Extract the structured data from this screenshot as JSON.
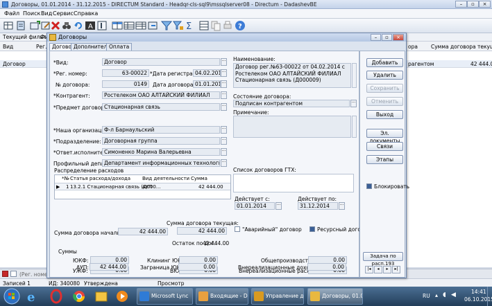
{
  "app": {
    "title": "Договоры, 01.01.2014 - 31.12.2015 - DIRECTUM Standard - Headqr-cls-sql9\\mssqlserver08 - Directum - DadashevBE",
    "menu": [
      "Файл",
      "Поиск",
      "Вид",
      "Сервис",
      "Справка"
    ],
    "filter_label": "Текущий фильтр",
    "filter_tail": "Фи",
    "grid_cols": {
      "vid": "Вид",
      "reg": "Рег.",
      "dog_short": "ора",
      "sum_current": "Сумма договора текущая"
    },
    "grid_row": {
      "vid": "Договор",
      "dog_short": "рагентом",
      "sum_current": "42 444.00"
    },
    "status_row_text": "(Рег. номер С",
    "status_left": "Записей 1",
    "status_id": "ИД: 340080",
    "status_state": "Утверждена",
    "status_mode": "Просмотр"
  },
  "dialog": {
    "title": "Договоры",
    "tabs": [
      "Договор",
      "Дополнительно",
      "Оплата"
    ],
    "form": {
      "vid_label": "*Вид:",
      "vid_value": "Договор",
      "reg_label": "*Рег. номер:",
      "reg_value": "63-00022",
      "reg_date_label": "*Дата регистрации:",
      "reg_date_value": "04.02.2014",
      "dog_no_label": "№ договора:",
      "dog_no_value": "0149",
      "dog_date_label": "Дата договора:",
      "dog_date_value": "01.01.2014",
      "contractor_label": "*Контрагент:",
      "contractor_value": "Ростелеком ОАО АЛТАЙСКИЙ ФИЛИАЛ",
      "subject_label": "*Предмет договора:",
      "subject_value": "Стационарная связь",
      "org_label": "*Наша организация:",
      "org_value": "Ф-л Барнаульский",
      "dept_label": "*Подразделение:",
      "dept_value": "Договорная группа",
      "resp_label": "*Ответ.исполнитель:",
      "resp_value": "Симоненко Марина Валерьевна",
      "profile_label": "Профильный департамент:",
      "profile_value": "Департамент информационных технологий",
      "name_label": "Наименование:",
      "name_value": "Договор рег.№63-00022 от 04.02.2014 с Ростелеком ОАО АЛТАЙСКИЙ ФИЛИАЛ Стационарная связь (Д000009)",
      "state_label": "Состояние договора:",
      "state_value": "Подписан контрагентом",
      "note_label": "Примечание:",
      "expenses_label": "Распределение расходов",
      "expenses_cols": [
        "*№",
        "Статья расхода/дохода",
        "Вид деятельности",
        "Сумма"
      ],
      "expenses_rows": [
        {
          "n": "1",
          "item": "13.2.1 Стационарная связь (Д000...",
          "activity": "АУП",
          "sum": "42 444.00"
        }
      ],
      "gtx_label": "Список договоров ГТХ:",
      "active_from_label": "Действует с:",
      "active_from_value": "01.01.2014",
      "active_to_label": "Действует по:",
      "active_to_value": "31.12.2014",
      "sum_current_label": "Сумма договора текущая:",
      "sum_current_value": "42 444.00",
      "sum_initial_label": "Сумма договора начальная:",
      "sum_initial_value": "42 444.00",
      "remain_label": "Остаток по дог.:",
      "remain_value": "42 444.00",
      "emergency_label": "\"Аварийный\" договор",
      "resource_label": "Ресурсный договор",
      "sums_label": "Суммы",
      "ukf_label": "ЮКФ:",
      "ukf_value": "0.00",
      "klining_label": "Клининг ЮКФ:",
      "klining_value": "0.00",
      "common_label": "Общепроизводственные:",
      "common_value": "0.00",
      "ujf_label": "УЖФ:",
      "ujf_value": "0.00",
      "vgu_label": "ВЮ:",
      "vgu_value": "0.00",
      "ext_exp_label": "Внереализационные расходы:",
      "ext_exp_value": "0.00",
      "aup_label": "АУП:",
      "aup_value": "42 444.00",
      "border_label": "Заграница ЮКФ:",
      "border_value": "0.00",
      "ext_inc_label": "Внереализационные доходы:",
      "ext_inc_value": "0.00"
    },
    "buttons": {
      "add": "Добавить",
      "delete": "Удалить",
      "save": "Сохранить",
      "cancel": "Отменить",
      "exit": "Выход",
      "edocs": "Эл. документы",
      "links": "Связи",
      "stages": "Этапы",
      "block": "Блокировать",
      "task": "Задача по расп.193"
    }
  },
  "taskbar": {
    "items": [
      "Microsoft Lync",
      "Входящие - Dada...",
      "Управление догов...",
      "Договоры, 01.01...."
    ],
    "lang": "RU",
    "time": "14:41",
    "date": "06.10.2015"
  },
  "colors": {
    "accent": "#2a5a9a",
    "taskbar": "#2b4a6b",
    "dialog_bg": "#dce4ef"
  }
}
